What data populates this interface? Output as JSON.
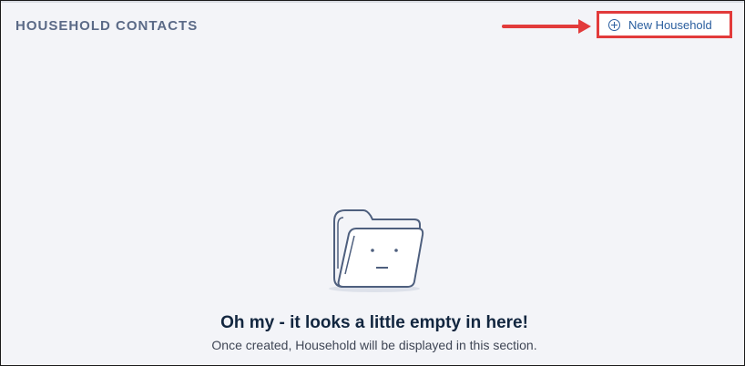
{
  "section": {
    "title": "HOUSEHOLD CONTACTS"
  },
  "actions": {
    "new_household_label": "New Household",
    "new_household_icon": "plus-circle-icon"
  },
  "annotation": {
    "arrow_color": "#e23b3b",
    "highlight_color": "#e23b3b"
  },
  "empty_state": {
    "icon": "empty-folder-face-icon",
    "title": "Oh my - it looks a little empty in here!",
    "subtitle": "Once created, Household will be displayed in this section."
  },
  "colors": {
    "background": "#f3f4f8",
    "title": "#5b6a87",
    "link": "#2a5e9e",
    "heading": "#12263f"
  }
}
